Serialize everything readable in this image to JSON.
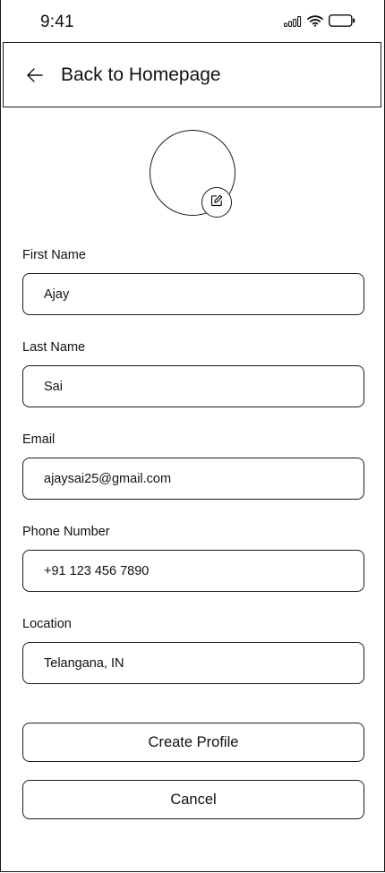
{
  "status_bar": {
    "time": "9:41",
    "icons": [
      "signal-icon",
      "wifi-icon",
      "battery-icon"
    ]
  },
  "header": {
    "back_icon": "arrow-left-icon",
    "title": "Back to Homepage"
  },
  "avatar": {
    "edit_icon": "edit-icon"
  },
  "form": {
    "first_name": {
      "label": "First Name",
      "value": "Ajay"
    },
    "last_name": {
      "label": "Last Name",
      "value": "Sai"
    },
    "email": {
      "label": "Email",
      "value": "ajaysai25@gmail.com"
    },
    "phone": {
      "label": "Phone Number",
      "value": "+91 123 456 7890"
    },
    "location": {
      "label": "Location",
      "value": "Telangana, IN"
    }
  },
  "actions": {
    "create_label": "Create Profile",
    "cancel_label": "Cancel"
  }
}
